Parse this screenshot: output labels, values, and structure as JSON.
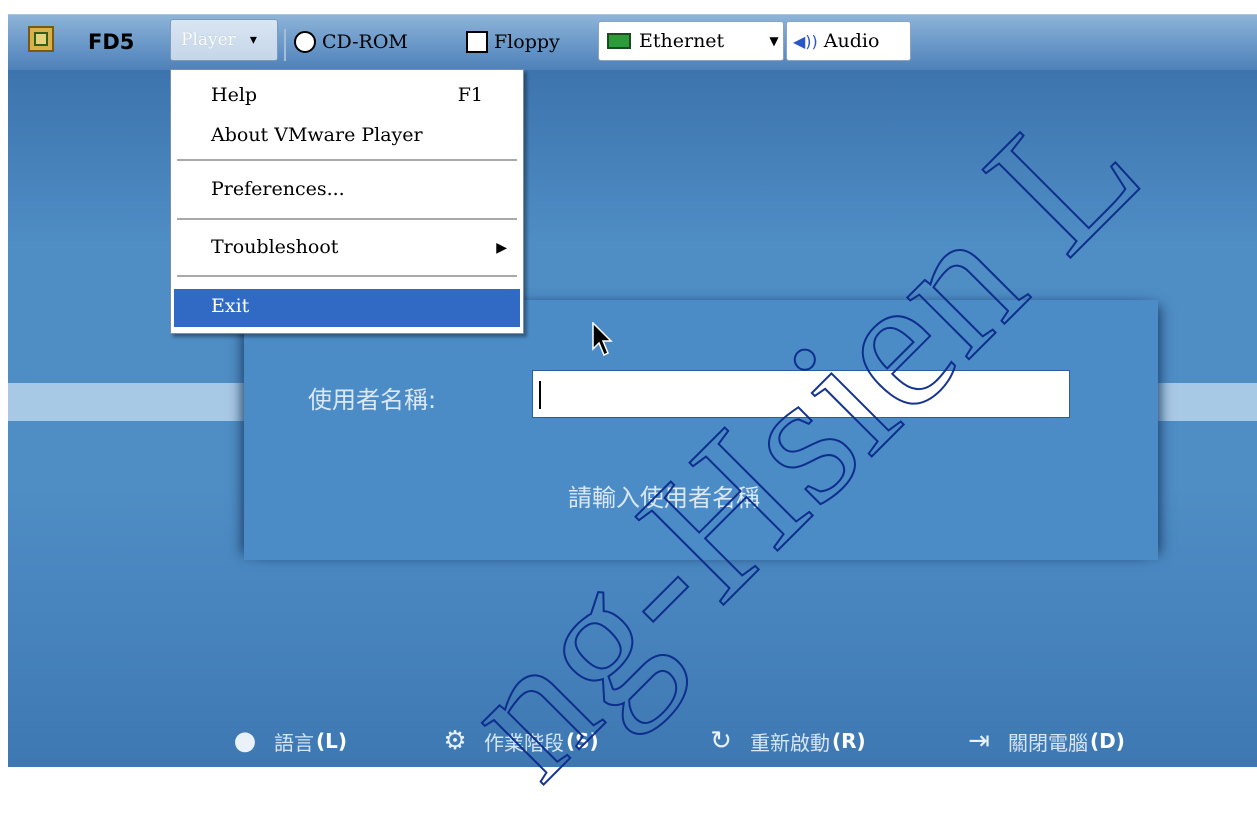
{
  "toolbar": {
    "app_name": "FD5",
    "player_label": "Player",
    "player_caret": "▾",
    "cdrom_label": "CD-ROM",
    "floppy_label": "Floppy",
    "ethernet_label": "Ethernet",
    "audio_label": "Audio"
  },
  "menu": {
    "help_label": "Help",
    "help_key": "F1",
    "about_label": "About VMware Player",
    "preferences_label": "Preferences...",
    "troubleshoot_label": "Troubleshoot",
    "exit_label": "Exit"
  },
  "login": {
    "username_label": "使用者名稱:",
    "username_value": "",
    "hint": "請輸入使用者名稱"
  },
  "actions": [
    {
      "label": "語言",
      "key": "(L)",
      "icon": "speech-bubble-icon"
    },
    {
      "label": "作業階段",
      "key": "(S)",
      "icon": "gears-icon"
    },
    {
      "label": "重新啟動",
      "key": "(R)",
      "icon": "restart-icon"
    },
    {
      "label": "關閉電腦",
      "key": "(D)",
      "icon": "shutdown-icon"
    }
  ],
  "watermark": "ng-Hsien L",
  "colors": {
    "menu_highlight": "#316ac5",
    "desktop_blue": "#4f8dc5",
    "toolbar_blue": "#6f9ccb"
  }
}
